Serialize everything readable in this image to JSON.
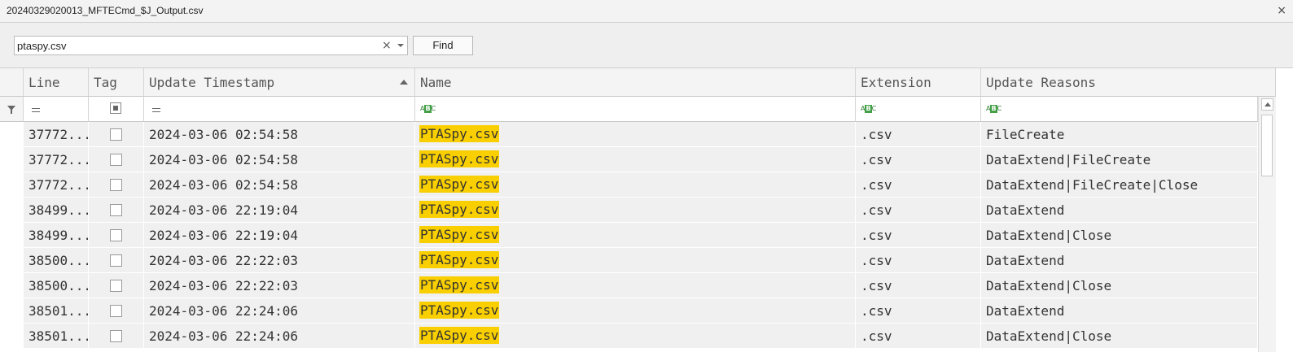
{
  "window": {
    "title": "20240329020013_MFTECmd_$J_Output.csv",
    "close_glyph": "×"
  },
  "find": {
    "value": "ptaspy.csv",
    "clear_glyph": "×",
    "find_label": "Find"
  },
  "columns": [
    {
      "key": "line",
      "label": "Line"
    },
    {
      "key": "tag",
      "label": "Tag"
    },
    {
      "key": "timestamp",
      "label": "Update Timestamp"
    },
    {
      "key": "name",
      "label": "Name"
    },
    {
      "key": "extension",
      "label": "Extension"
    },
    {
      "key": "reasons",
      "label": "Update Reasons"
    }
  ],
  "sorted_column": "timestamp",
  "sort_direction": "ascending",
  "highlight_color": "#f9cf00",
  "rows": [
    {
      "line": "37772...",
      "timestamp": "2024-03-06 02:54:58",
      "name": "PTASpy.csv",
      "extension": ".csv",
      "reasons": "FileCreate"
    },
    {
      "line": "37772...",
      "timestamp": "2024-03-06 02:54:58",
      "name": "PTASpy.csv",
      "extension": ".csv",
      "reasons": "DataExtend|FileCreate"
    },
    {
      "line": "37772...",
      "timestamp": "2024-03-06 02:54:58",
      "name": "PTASpy.csv",
      "extension": ".csv",
      "reasons": "DataExtend|FileCreate|Close"
    },
    {
      "line": "38499...",
      "timestamp": "2024-03-06 22:19:04",
      "name": "PTASpy.csv",
      "extension": ".csv",
      "reasons": "DataExtend"
    },
    {
      "line": "38499...",
      "timestamp": "2024-03-06 22:19:04",
      "name": "PTASpy.csv",
      "extension": ".csv",
      "reasons": "DataExtend|Close"
    },
    {
      "line": "38500...",
      "timestamp": "2024-03-06 22:22:03",
      "name": "PTASpy.csv",
      "extension": ".csv",
      "reasons": "DataExtend"
    },
    {
      "line": "38500...",
      "timestamp": "2024-03-06 22:22:03",
      "name": "PTASpy.csv",
      "extension": ".csv",
      "reasons": "DataExtend|Close"
    },
    {
      "line": "38501...",
      "timestamp": "2024-03-06 22:24:06",
      "name": "PTASpy.csv",
      "extension": ".csv",
      "reasons": "DataExtend"
    },
    {
      "line": "38501...",
      "timestamp": "2024-03-06 22:24:06",
      "name": "PTASpy.csv",
      "extension": ".csv",
      "reasons": "DataExtend|Close"
    }
  ]
}
